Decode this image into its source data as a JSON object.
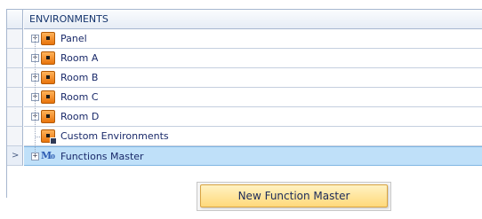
{
  "tree": {
    "header": "ENVIRONMENTS",
    "nodes": [
      {
        "label": "Panel",
        "icon": "room-icon"
      },
      {
        "label": "Room A",
        "icon": "room-icon"
      },
      {
        "label": "Room B",
        "icon": "room-icon"
      },
      {
        "label": "Room C",
        "icon": "room-icon"
      },
      {
        "label": "Room D",
        "icon": "room-icon"
      },
      {
        "label": "Custom Environments",
        "icon": "custom-environment-icon"
      },
      {
        "label": "Functions Master",
        "icon": "functions-master-icon"
      }
    ],
    "expander_glyph": "+",
    "row_pointer_glyph": ">",
    "functions_master_glyph": "M₀"
  },
  "context_menu": {
    "items": [
      {
        "label": "New Function Master"
      }
    ]
  },
  "colors": {
    "selected_row": "#bfe0f9",
    "room_icon": "#f08a1c",
    "menu_highlight": "#ffd97a"
  }
}
